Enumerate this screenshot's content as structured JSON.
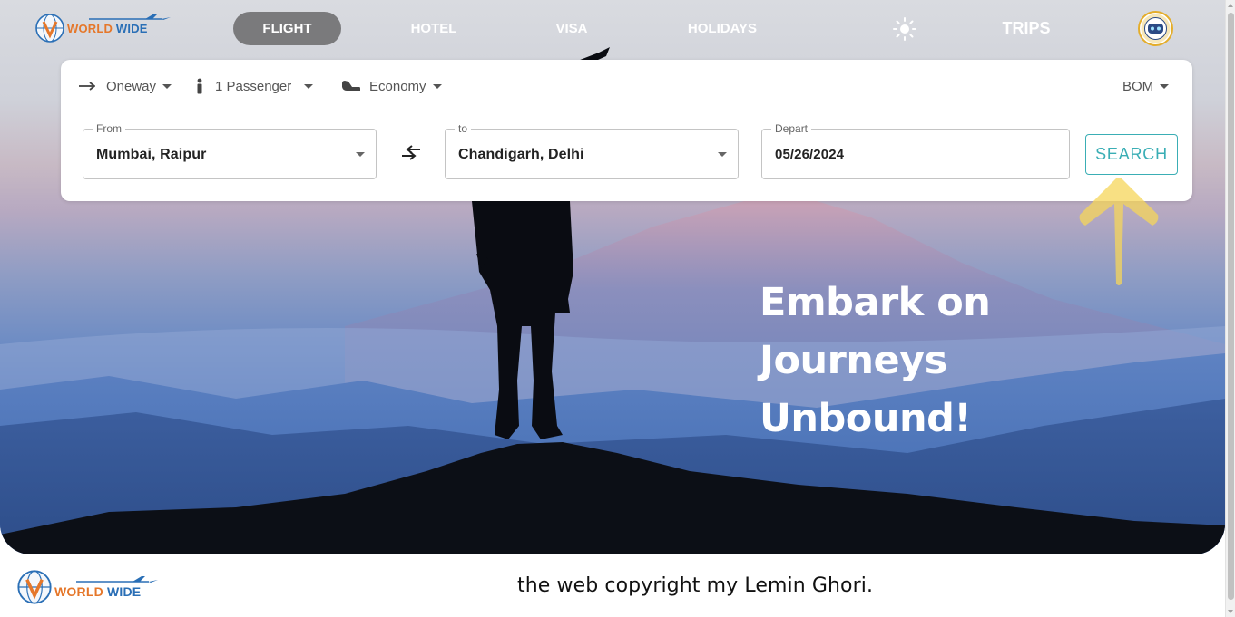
{
  "brand": {
    "word_part1": "WORLD",
    "word_part2": "WIDE",
    "colors": {
      "orange": "#e5772a",
      "blue": "#2a6fb6"
    }
  },
  "nav": {
    "flight": "FLIGHT",
    "hotel": "HOTEL",
    "visa": "VISA",
    "holidays": "HOLIDAYS",
    "trips": "TRIPS",
    "theme_icon": "sun-icon",
    "active": "flight"
  },
  "search": {
    "trip_type": "Oneway",
    "passengers": "1 Passenger",
    "cabin_class": "Economy",
    "currency": "BOM",
    "from": {
      "label": "From",
      "value": "Mumbai, Raipur"
    },
    "to": {
      "label": "to",
      "value": "Chandigarh, Delhi"
    },
    "depart": {
      "label": "Depart",
      "value": "05/26/2024"
    },
    "search_label": "SEARCH"
  },
  "hero": {
    "headline_line1": "Embark on",
    "headline_line2": "Journeys",
    "headline_line3": "Unbound!"
  },
  "footer": {
    "copyright": "the web copyright my Lemin Ghori."
  },
  "colors": {
    "accent": "#3aaeb5",
    "nav_active_bg": "#7a7a7c",
    "hint_arrow": "#f5d55a"
  }
}
